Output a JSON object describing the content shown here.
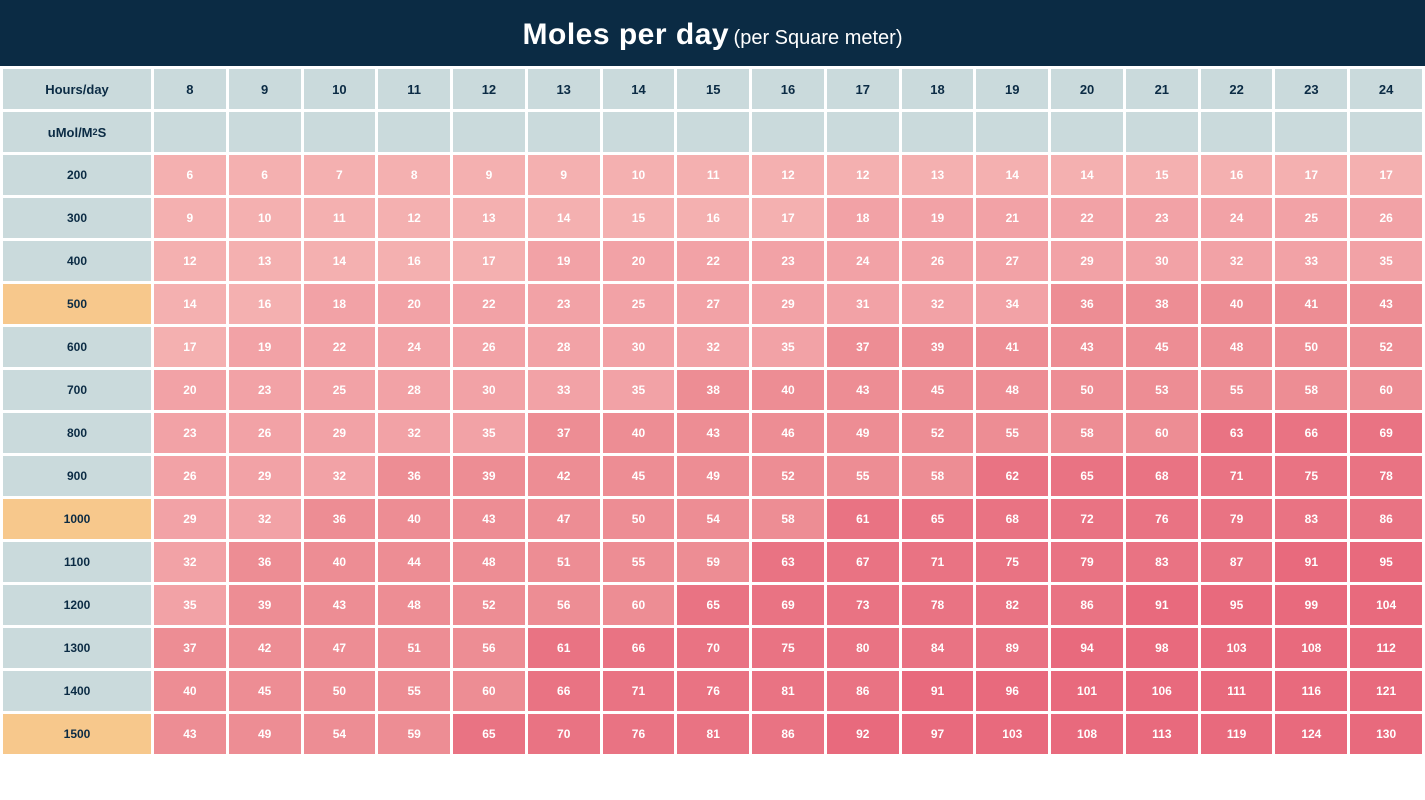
{
  "header": {
    "title": "Moles per day",
    "subtitle": "(per Square meter)"
  },
  "labels": {
    "hours": "Hours/day",
    "umol_pre": "uMol/M",
    "umol_sup": "2",
    "umol_post": "S"
  },
  "hours": [
    8,
    9,
    10,
    11,
    12,
    13,
    14,
    15,
    16,
    17,
    18,
    19,
    20,
    21,
    22,
    23,
    24
  ],
  "rows": [
    {
      "umol": 200,
      "hl": false,
      "v": [
        6,
        6,
        7,
        8,
        9,
        9,
        10,
        11,
        12,
        12,
        13,
        14,
        14,
        15,
        16,
        17,
        17
      ]
    },
    {
      "umol": 300,
      "hl": false,
      "v": [
        9,
        10,
        11,
        12,
        13,
        14,
        15,
        16,
        17,
        18,
        19,
        21,
        22,
        23,
        24,
        25,
        26
      ]
    },
    {
      "umol": 400,
      "hl": false,
      "v": [
        12,
        13,
        14,
        16,
        17,
        19,
        20,
        22,
        23,
        24,
        26,
        27,
        29,
        30,
        32,
        33,
        35
      ]
    },
    {
      "umol": 500,
      "hl": true,
      "v": [
        14,
        16,
        18,
        20,
        22,
        23,
        25,
        27,
        29,
        31,
        32,
        34,
        36,
        38,
        40,
        41,
        43
      ]
    },
    {
      "umol": 600,
      "hl": false,
      "v": [
        17,
        19,
        22,
        24,
        26,
        28,
        30,
        32,
        35,
        37,
        39,
        41,
        43,
        45,
        48,
        50,
        52
      ]
    },
    {
      "umol": 700,
      "hl": false,
      "v": [
        20,
        23,
        25,
        28,
        30,
        33,
        35,
        38,
        40,
        43,
        45,
        48,
        50,
        53,
        55,
        58,
        60
      ]
    },
    {
      "umol": 800,
      "hl": false,
      "v": [
        23,
        26,
        29,
        32,
        35,
        37,
        40,
        43,
        46,
        49,
        52,
        55,
        58,
        60,
        63,
        66,
        69
      ]
    },
    {
      "umol": 900,
      "hl": false,
      "v": [
        26,
        29,
        32,
        36,
        39,
        42,
        45,
        49,
        52,
        55,
        58,
        62,
        65,
        68,
        71,
        75,
        78
      ]
    },
    {
      "umol": 1000,
      "hl": true,
      "v": [
        29,
        32,
        36,
        40,
        43,
        47,
        50,
        54,
        58,
        61,
        65,
        68,
        72,
        76,
        79,
        83,
        86
      ]
    },
    {
      "umol": 1100,
      "hl": false,
      "v": [
        32,
        36,
        40,
        44,
        48,
        51,
        55,
        59,
        63,
        67,
        71,
        75,
        79,
        83,
        87,
        91,
        95
      ]
    },
    {
      "umol": 1200,
      "hl": false,
      "v": [
        35,
        39,
        43,
        48,
        52,
        56,
        60,
        65,
        69,
        73,
        78,
        82,
        86,
        91,
        95,
        99,
        104
      ]
    },
    {
      "umol": 1300,
      "hl": false,
      "v": [
        37,
        42,
        47,
        51,
        56,
        61,
        66,
        70,
        75,
        80,
        84,
        89,
        94,
        98,
        103,
        108,
        112
      ]
    },
    {
      "umol": 1400,
      "hl": false,
      "v": [
        40,
        45,
        50,
        55,
        60,
        66,
        71,
        76,
        81,
        86,
        91,
        96,
        101,
        106,
        111,
        116,
        121
      ]
    },
    {
      "umol": 1500,
      "hl": true,
      "v": [
        43,
        49,
        54,
        59,
        65,
        70,
        76,
        81,
        86,
        92,
        97,
        103,
        108,
        113,
        119,
        124,
        130
      ]
    }
  ],
  "chart_data": {
    "type": "heatmap",
    "title": "Moles per day (per Square meter)",
    "xlabel": "Hours/day",
    "ylabel": "uMol/M²S",
    "x": [
      8,
      9,
      10,
      11,
      12,
      13,
      14,
      15,
      16,
      17,
      18,
      19,
      20,
      21,
      22,
      23,
      24
    ],
    "y": [
      200,
      300,
      400,
      500,
      600,
      700,
      800,
      900,
      1000,
      1100,
      1200,
      1300,
      1400,
      1500
    ],
    "z": [
      [
        6,
        6,
        7,
        8,
        9,
        9,
        10,
        11,
        12,
        12,
        13,
        14,
        14,
        15,
        16,
        17,
        17
      ],
      [
        9,
        10,
        11,
        12,
        13,
        14,
        15,
        16,
        17,
        18,
        19,
        21,
        22,
        23,
        24,
        25,
        26
      ],
      [
        12,
        13,
        14,
        16,
        17,
        19,
        20,
        22,
        23,
        24,
        26,
        27,
        29,
        30,
        32,
        33,
        35
      ],
      [
        14,
        16,
        18,
        20,
        22,
        23,
        25,
        27,
        29,
        31,
        32,
        34,
        36,
        38,
        40,
        41,
        43
      ],
      [
        17,
        19,
        22,
        24,
        26,
        28,
        30,
        32,
        35,
        37,
        39,
        41,
        43,
        45,
        48,
        50,
        52
      ],
      [
        20,
        23,
        25,
        28,
        30,
        33,
        35,
        38,
        40,
        43,
        45,
        48,
        50,
        53,
        55,
        58,
        60
      ],
      [
        23,
        26,
        29,
        32,
        35,
        37,
        40,
        43,
        46,
        49,
        52,
        55,
        58,
        60,
        63,
        66,
        69
      ],
      [
        26,
        29,
        32,
        36,
        39,
        42,
        45,
        49,
        52,
        55,
        58,
        62,
        65,
        68,
        71,
        75,
        78
      ],
      [
        29,
        32,
        36,
        40,
        43,
        47,
        50,
        54,
        58,
        61,
        65,
        68,
        72,
        76,
        79,
        83,
        86
      ],
      [
        32,
        36,
        40,
        44,
        48,
        51,
        55,
        59,
        63,
        67,
        71,
        75,
        79,
        83,
        87,
        91,
        95
      ],
      [
        35,
        39,
        43,
        48,
        52,
        56,
        60,
        65,
        69,
        73,
        78,
        82,
        86,
        91,
        95,
        99,
        104
      ],
      [
        37,
        42,
        47,
        51,
        56,
        61,
        66,
        70,
        75,
        80,
        84,
        89,
        94,
        98,
        103,
        108,
        112
      ],
      [
        40,
        45,
        50,
        55,
        60,
        66,
        71,
        76,
        81,
        86,
        91,
        96,
        101,
        106,
        111,
        116,
        121
      ],
      [
        43,
        49,
        54,
        59,
        65,
        70,
        76,
        81,
        86,
        92,
        97,
        103,
        108,
        113,
        119,
        124,
        130
      ]
    ],
    "palette": [
      "#f4b0b0",
      "#f2a2a6",
      "#ed8d94",
      "#e97383",
      "#e86a7d"
    ],
    "highlight_rows_y": [
      500,
      1000,
      1500
    ]
  }
}
